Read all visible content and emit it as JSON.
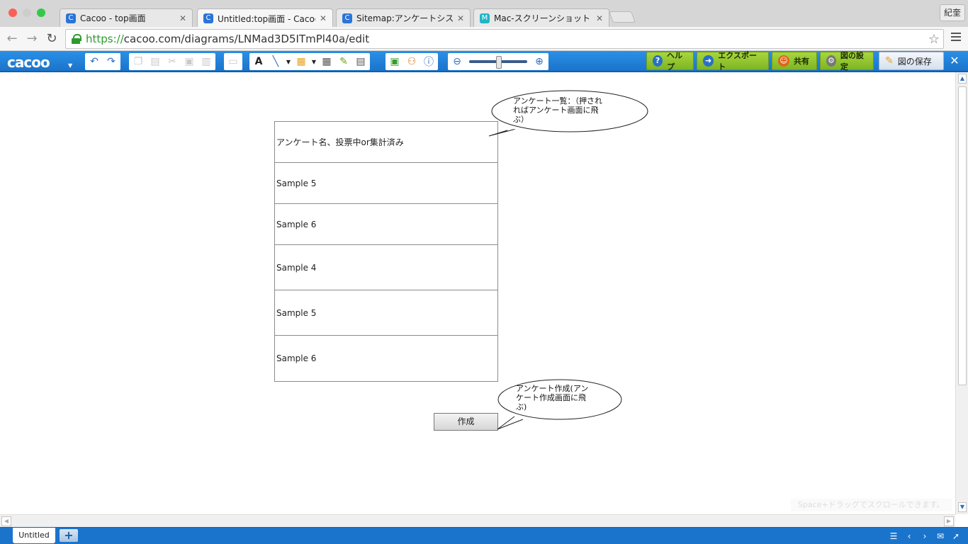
{
  "browser": {
    "tabs": [
      {
        "title": "Cacoo - top画面",
        "favicon": "C"
      },
      {
        "title": "Untitled:top画面 - Cacoo",
        "favicon": "C"
      },
      {
        "title": "Sitemap:アンケートシステム",
        "favicon": "C"
      },
      {
        "title": "Mac-スクリーンショット | 初",
        "favicon": "M"
      }
    ],
    "user": "紀奎",
    "url_https": "https://",
    "url_rest": "cacoo.com/diagrams/LNMad3D5ITmPl40a/edit"
  },
  "app": {
    "logo": "cacoo",
    "buttons": {
      "help": "ヘルプ",
      "export": "エクスポート",
      "share": "共有",
      "settings": "図の設定",
      "save": "図の保存"
    },
    "brand_color": "#1b74cb",
    "accent_green": "#8cc43a"
  },
  "diagram": {
    "rows": [
      "アンケート名、投票中or集計済み",
      "Sample 5",
      "Sample 6",
      "Sample 4",
      "Sample 5",
      "Sample 6"
    ],
    "create_button": "作成",
    "callout_list": [
      "アンケート一覧：（押され",
      "ればアンケート画面に飛",
      "ぶ）"
    ],
    "callout_create": [
      "アンケート作成(アン",
      "ケート作成画面に飛",
      "ぶ)"
    ],
    "hint": "Space+ドラッグでスクロールできます。"
  },
  "footer": {
    "sheet_tab": "Untitled",
    "add_sheet": "+"
  }
}
